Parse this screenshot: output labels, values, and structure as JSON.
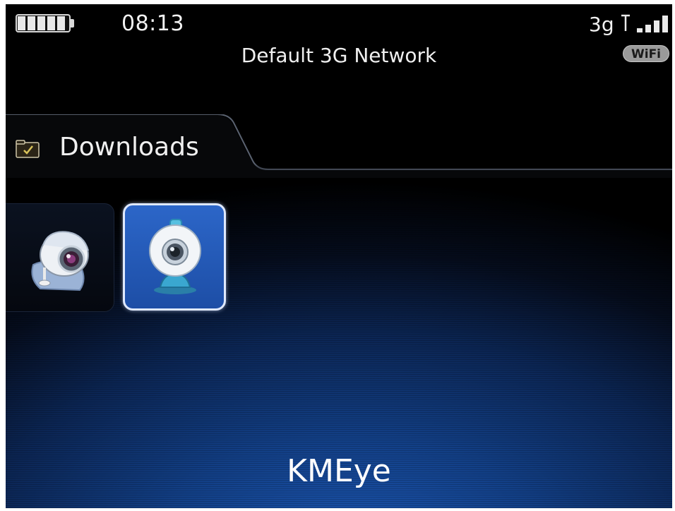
{
  "status_bar": {
    "time": "08:13",
    "network_name": "Default 3G Network",
    "network_type": "3g",
    "wifi_label": "WiFi",
    "battery_level": 1.0,
    "battery_icon": "battery-icon",
    "signal_icon": "signal-strength-icon",
    "signal_bars": 4
  },
  "folder": {
    "icon": "folder-icon",
    "label": "Downloads"
  },
  "apps": [
    {
      "icon": "webcam-app-icon",
      "selected": false
    },
    {
      "icon": "kmeye-webcam-icon",
      "selected": true
    }
  ],
  "selected_app_caption": "KMEye",
  "colors": {
    "background_top": "#000000",
    "background_glow": "#1b55b0",
    "selection_fill": "#2c66c8",
    "selection_border": "#dfe9ff",
    "text": "#ffffff"
  }
}
